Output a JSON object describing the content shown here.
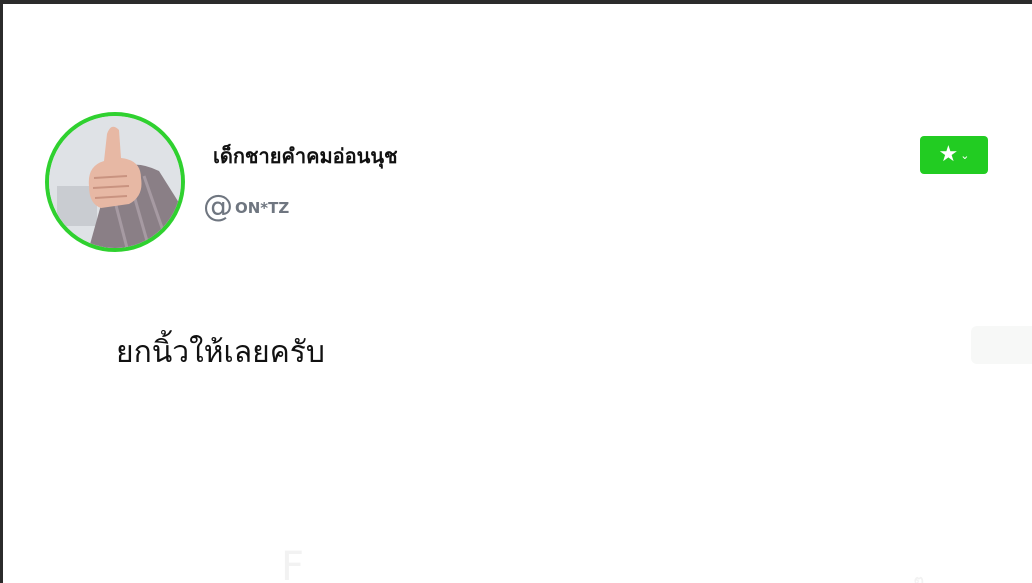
{
  "profile": {
    "display_name": "เด็กชายคำคมอ่อนนุช",
    "handle_prefix": "@",
    "handle": "ON*TZ",
    "avatar_description": "thumbs-up-photo"
  },
  "actions": {
    "star_button_icon": "star-icon",
    "star_button_chevron": "chevron-down-icon",
    "star_button_color": "#22cc22"
  },
  "post": {
    "text": "ยกนิ้วให้เลยครับ"
  },
  "colors": {
    "avatar_ring": "#2fd12f",
    "frame_border": "#2b2b2b",
    "handle_text": "#6f7680"
  }
}
